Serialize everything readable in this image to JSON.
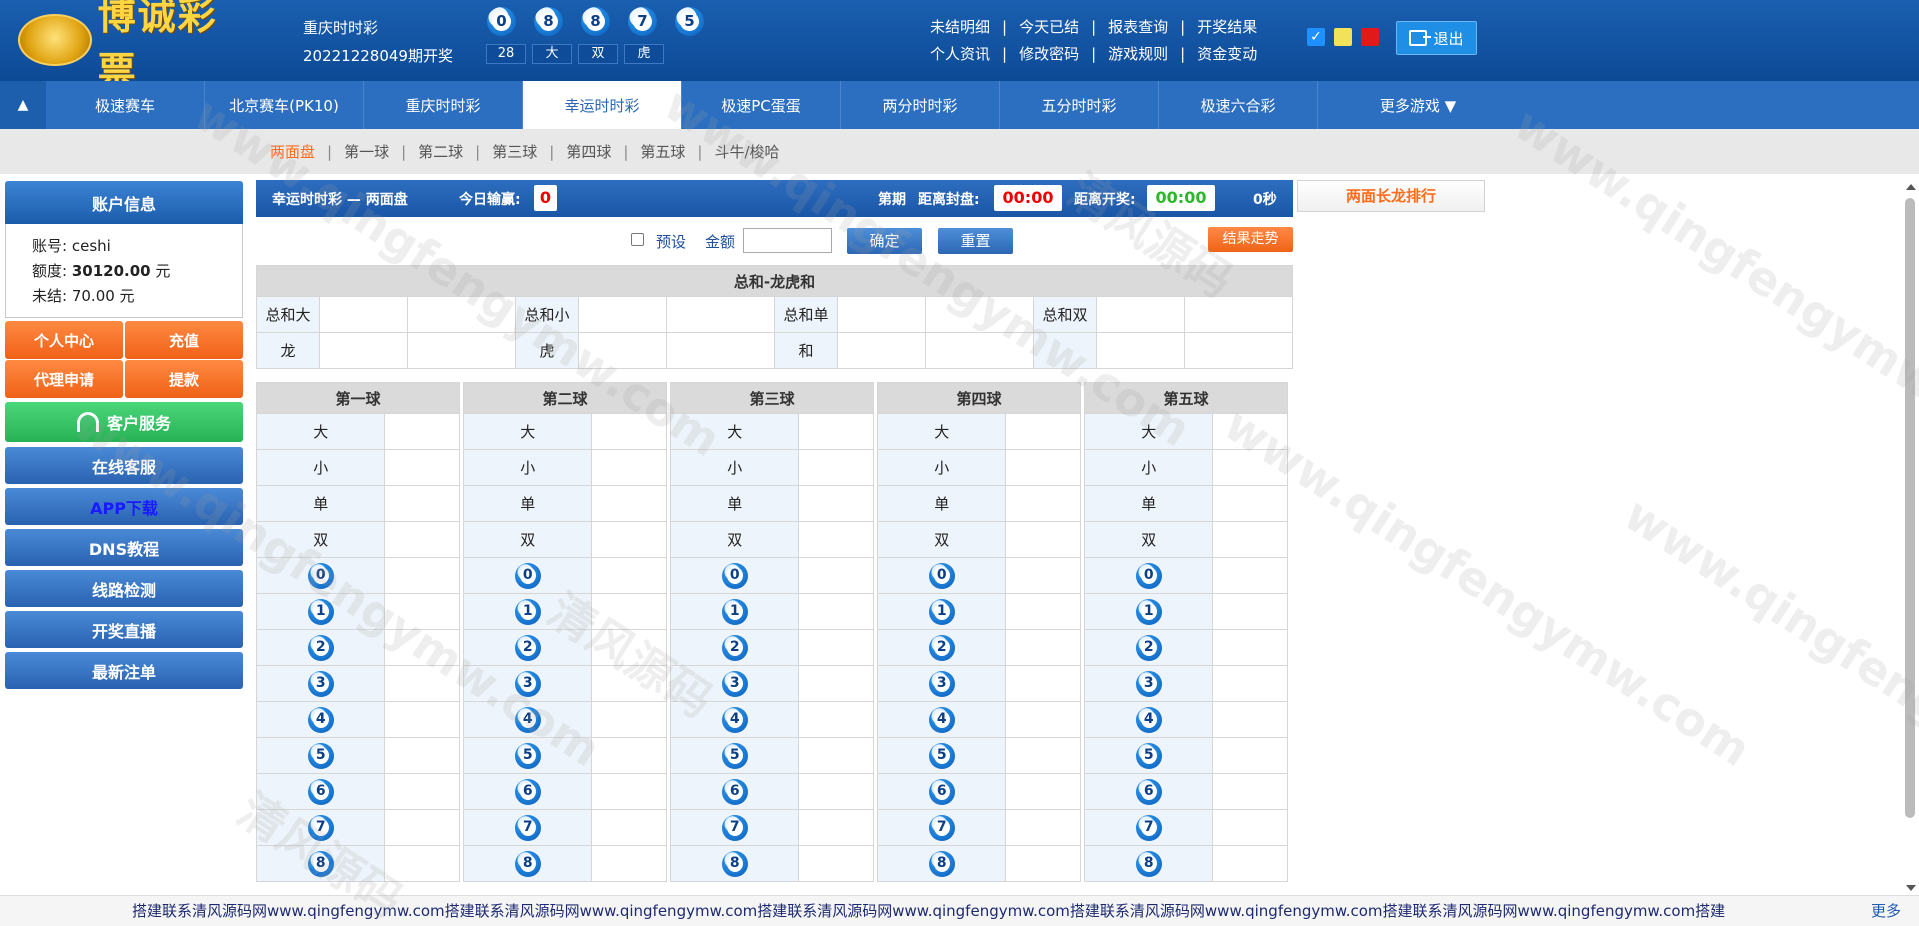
{
  "header": {
    "logo_text": "博诚彩票",
    "lottery_name": "重庆时时彩",
    "issue_text": "20221228049期开奖",
    "balls": [
      "0",
      "8",
      "8",
      "7",
      "5"
    ],
    "tags": [
      "28",
      "大",
      "双",
      "虎"
    ],
    "links_row1": [
      "未结明细",
      "今天已结",
      "报表查询",
      "开奖结果"
    ],
    "links_row2": [
      "个人资讯",
      "修改密码",
      "游戏规则",
      "资金变动"
    ],
    "theme_colors": [
      "#1e90ff",
      "#f2e25a",
      "#e01919"
    ],
    "logout_label": "退出"
  },
  "nav": {
    "items": [
      "极速赛车",
      "北京赛车(PK10)",
      "重庆时时彩",
      "幸运时时彩",
      "极速PC蛋蛋",
      "两分时时彩",
      "五分时时彩",
      "极速六合彩"
    ],
    "more_label": "更多游戏 ▼",
    "active": "幸运时时彩"
  },
  "subnav": {
    "items": [
      "两面盘",
      "第一球",
      "第二球",
      "第三球",
      "第四球",
      "第五球",
      "斗牛/梭哈"
    ],
    "active": "两面盘"
  },
  "sidebar": {
    "account_title": "账户信息",
    "account_label": "账号:",
    "account_value": "ceshi",
    "credit_label": "额度:",
    "credit_value": "30120.00",
    "credit_unit": "元",
    "unsettled_label": "未结:",
    "unsettled_value": "70.00 元",
    "orange_buttons": [
      "个人中心",
      "充值",
      "代理申请",
      "提款"
    ],
    "service_label": "客户服务",
    "blue_buttons": [
      "在线客服",
      "APP下载",
      "DNS教程",
      "线路检测",
      "开奖直播",
      "最新注单"
    ]
  },
  "main": {
    "bar_title": "幸运时时彩 — 两面盘",
    "today_win_label": "今日输赢:",
    "today_win_value": "0",
    "issue_label": "第期",
    "close_label": "距离封盘:",
    "close_time": "00:00",
    "draw_label": "距离开奖:",
    "draw_time": "00:00",
    "seconds": "0秒",
    "preset_label": "预设",
    "amount_label": "金额",
    "amount_value": "",
    "confirm_label": "确定",
    "reset_label": "重置",
    "trend_label": "结果走势"
  },
  "sum_table": {
    "title": "总和-龙虎和",
    "row1": [
      "总和大",
      "总和小",
      "总和单",
      "总和双"
    ],
    "row2": [
      "龙",
      "虎",
      "和"
    ]
  },
  "ball_columns": {
    "titles": [
      "第一球",
      "第二球",
      "第三球",
      "第四球",
      "第五球"
    ],
    "text_rows": [
      "大",
      "小",
      "单",
      "双"
    ],
    "number_rows": [
      "0",
      "1",
      "2",
      "3",
      "4",
      "5",
      "6",
      "7",
      "8"
    ]
  },
  "right": {
    "long_rank_label": "两面长龙排行"
  },
  "ticker": {
    "text": "搭建联系清风源码网www.qingfengymw.com搭建联系清风源码网www.qingfengymw.com搭建联系清风源码网www.qingfengymw.com搭建联系清风源码网www.qingfengymw.com搭建联系清风源码网www.qingfengymw.com搭建",
    "more_label": "更多"
  },
  "watermark": {
    "text": "www.qingfengymw.com",
    "cn_text": "清风源码"
  }
}
